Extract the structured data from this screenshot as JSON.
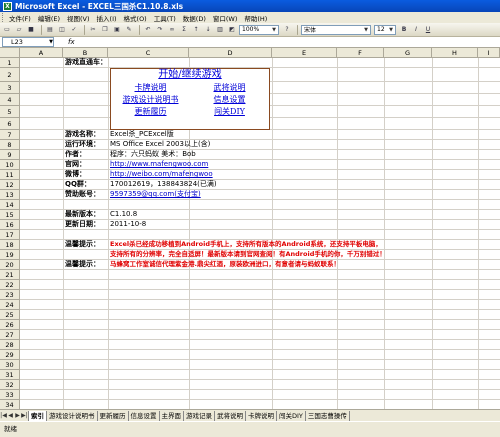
{
  "window": {
    "title": "Microsoft Excel - EXCEL三国杀C1.10.8.xls"
  },
  "menu": [
    "文件(F)",
    "编辑(E)",
    "视图(V)",
    "插入(I)",
    "格式(O)",
    "工具(T)",
    "数据(D)",
    "窗口(W)",
    "帮助(H)"
  ],
  "toolbar": {
    "zoom": "100%",
    "font": "宋体",
    "size": "12"
  },
  "formula": {
    "namebox": "L23",
    "fx": "fx",
    "content": ""
  },
  "columns": [
    "A",
    "B",
    "C",
    "D",
    "E",
    "F",
    "G",
    "H",
    "I"
  ],
  "rows": [
    "1",
    "2",
    "3",
    "4",
    "5",
    "6",
    "7",
    "8",
    "9",
    "10",
    "11",
    "12",
    "13",
    "14",
    "15",
    "16",
    "17",
    "18",
    "19",
    "20",
    "21",
    "22",
    "23",
    "24",
    "25",
    "26",
    "27",
    "28",
    "29",
    "30",
    "31",
    "32",
    "33",
    "34",
    "35"
  ],
  "cells": {
    "b1": "游戏直通车：",
    "menu_start": "开始/继续游戏",
    "menu_cards": "卡牌说明",
    "menu_generals": "武将说明",
    "menu_design": "游戏设计说明书",
    "menu_settings": "信息设置",
    "menu_history": "更新履历",
    "menu_diy": "闯关DIY",
    "name_label": "游戏名称：",
    "name_value": "Excel杀_PCExcel版",
    "env_label": "运行环境：",
    "env_value": "MS Office Excel 2003以上(含)",
    "author_label": "作者：",
    "author_value": "程序：六只蚂蚁      美术：Bob",
    "site_label": "官网：",
    "site_value": "http://www.mafengwoo.com",
    "weibo_label": "微博：",
    "weibo_value": "http://weibo.com/mafengwoo",
    "qq_label": "QQ群：",
    "qq_value": "170012619，138843824(已满)",
    "donate_label": "赞助账号：",
    "donate_value": "9597359@qq.com(支付宝)",
    "version_label": "最新版本：",
    "version_value": "C1.10.8",
    "date_label": "更新日期：",
    "date_value": "2011-10-8",
    "notice1_label": "温馨提示：",
    "notice1_line1": "Excel杀已经成功移植到Android手机上，支持所有版本的Android系统，还支持平板电脑，",
    "notice1_line2": "支持所有的分辨率，完全自适屏！最新版本请到官网查阅！有Android手机的你，千万别错过！",
    "notice2_label": "温馨提示：",
    "notice2_value": "马蜂窝工作室诚信代理紫金港.鼎尖红酒，原装欧洲进口，有意者请与蚂蚁联系！"
  },
  "tabs": [
    "索引",
    "游戏设计说明书",
    "更新履历",
    "信息设置",
    "主界面",
    "游戏记录",
    "武将说明",
    "卡牌说明",
    "闯关DIY",
    "三国志曹操传"
  ],
  "status": "就绪"
}
